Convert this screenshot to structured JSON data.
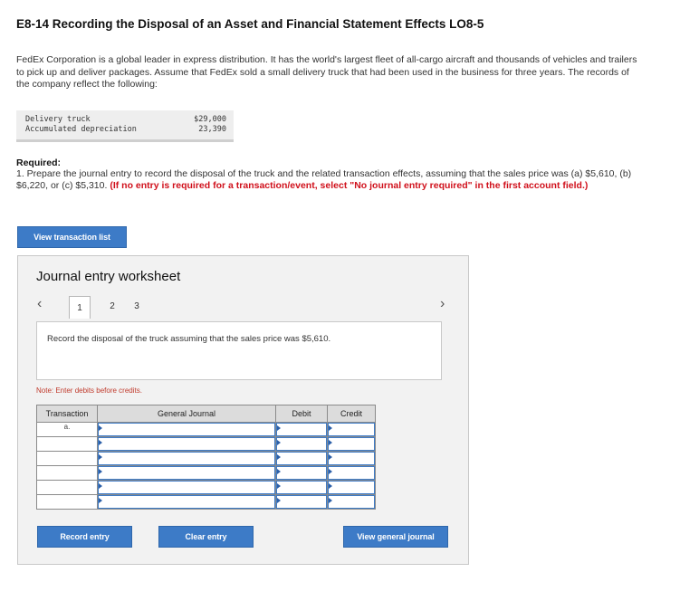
{
  "header": {
    "title": "E8-14 Recording the Disposal of an Asset and Financial Statement Effects LO8-5"
  },
  "intro": "FedEx Corporation is a global leader in express distribution. It has the world's largest fleet of all-cargo aircraft and thousands of vehicles and trailers to pick up and deliver packages. Assume that FedEx sold a small delivery truck that had been used in the business for three years. The records of the company reflect the following:",
  "records": [
    {
      "label": "Delivery truck",
      "value": "$29,000"
    },
    {
      "label": "Accumulated depreciation",
      "value": "23,390"
    }
  ],
  "required": {
    "heading": "Required:",
    "text": "1. Prepare the journal entry to record the disposal of the truck and the related transaction effects, assuming that the sales price was (a) $5,610, (b) $6,220, or (c) $5,310.",
    "note": "(If no entry is required for a transaction/event, select \"No journal entry required\" in the first account field.)"
  },
  "buttons": {
    "view_transaction_list": "View transaction list",
    "record_entry": "Record entry",
    "clear_entry": "Clear entry",
    "view_general_journal": "View general journal"
  },
  "worksheet": {
    "title": "Journal entry worksheet",
    "pages": [
      "1",
      "2",
      "3"
    ],
    "active_page": "1",
    "prev_icon": "‹",
    "next_icon": "›",
    "instruction": "Record the disposal of the truck assuming that the sales price was $5,610.",
    "note": "Note: Enter debits before credits.",
    "columns": [
      "Transaction",
      "General Journal",
      "Debit",
      "Credit"
    ],
    "rows": [
      "a.",
      "",
      "",
      "",
      "",
      ""
    ]
  },
  "colors": {
    "accent": "#3d7bc7",
    "warning": "#d0101b"
  }
}
